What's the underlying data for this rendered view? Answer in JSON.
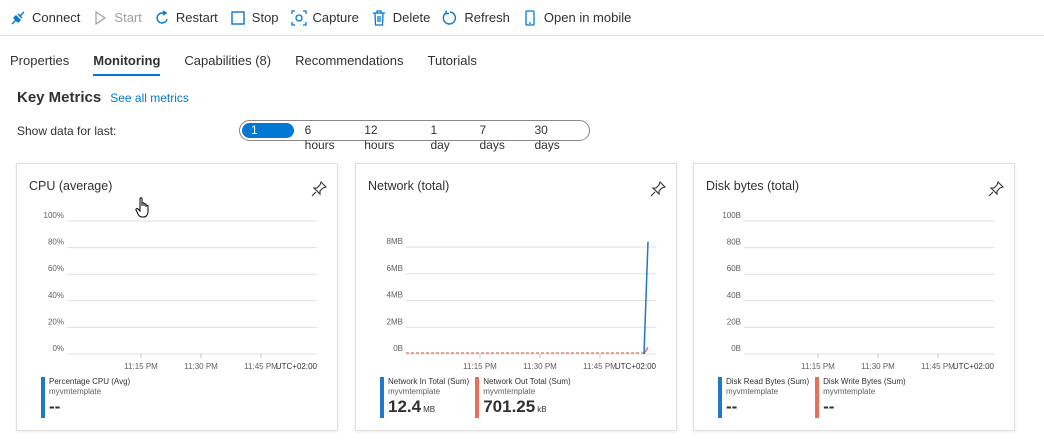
{
  "toolbar": {
    "connect": "Connect",
    "start": "Start",
    "restart": "Restart",
    "stop": "Stop",
    "capture": "Capture",
    "delete": "Delete",
    "refresh": "Refresh",
    "open_mobile": "Open in mobile"
  },
  "tabs": [
    "Properties",
    "Monitoring",
    "Capabilities (8)",
    "Recommendations",
    "Tutorials"
  ],
  "active_tab": "Monitoring",
  "key_metrics": {
    "title": "Key Metrics",
    "link": "See all metrics"
  },
  "show_data": {
    "label": "Show data for last:",
    "options": [
      "1 hour",
      "6 hours",
      "12 hours",
      "1 day",
      "7 days",
      "30 days"
    ],
    "selected": "1 hour"
  },
  "colors": {
    "accent": "#0078d4",
    "series_blue": "#1f78c8",
    "series_orange": "#e8705a"
  },
  "cards": [
    {
      "title": "CPU (average)",
      "chart_data": {
        "type": "line",
        "y_ticks": [
          "100%",
          "80%",
          "60%",
          "40%",
          "20%",
          "0%"
        ],
        "x_ticks": [
          "11:15 PM",
          "11:30 PM",
          "11:45 PM"
        ],
        "timezone": "UTC+02:00",
        "series": [
          {
            "name": "Percentage CPU (Avg)",
            "x": [],
            "y": []
          }
        ]
      },
      "legend": [
        {
          "name": "Percentage CPU (Avg)",
          "resource": "myvmtemplate",
          "value": "--",
          "unit": "",
          "color": "#1f78c8"
        }
      ]
    },
    {
      "title": "Network (total)",
      "chart_data": {
        "type": "line",
        "y_ticks": [
          "8MB",
          "6MB",
          "4MB",
          "2MB",
          "0B"
        ],
        "y_values_mb": [
          8,
          6,
          4,
          2,
          0
        ],
        "x_ticks": [
          "11:15 PM",
          "11:30 PM",
          "11:45 PM"
        ],
        "timezone": "UTC+02:00",
        "series": [
          {
            "name": "Network In Total (Sum)",
            "x": [
              "11:56 PM",
              "11:57 PM"
            ],
            "y": [
              0,
              8.4
            ]
          },
          {
            "name": "Network Out Total (Sum)",
            "x": [
              "11:56 PM",
              "11:57 PM"
            ],
            "y": [
              0,
              0.5
            ]
          }
        ]
      },
      "legend": [
        {
          "name": "Network In Total (Sum)",
          "resource": "myvmtemplate",
          "value": "12.4",
          "unit": "MB",
          "color": "#1f78c8"
        },
        {
          "name": "Network Out Total (Sum)",
          "resource": "myvmtemplate",
          "value": "701.25",
          "unit": "kB",
          "color": "#e8705a"
        }
      ]
    },
    {
      "title": "Disk bytes (total)",
      "chart_data": {
        "type": "line",
        "y_ticks": [
          "100B",
          "80B",
          "60B",
          "40B",
          "20B",
          "0B"
        ],
        "x_ticks": [
          "11:15 PM",
          "11:30 PM",
          "11:45 PM"
        ],
        "timezone": "UTC+02:00",
        "series": [
          {
            "name": "Disk Read Bytes (Sum)",
            "x": [],
            "y": []
          },
          {
            "name": "Disk Write Bytes (Sum)",
            "x": [],
            "y": []
          }
        ]
      },
      "legend": [
        {
          "name": "Disk Read Bytes (Sum)",
          "resource": "myvmtemplate",
          "value": "--",
          "unit": "",
          "color": "#1f78c8"
        },
        {
          "name": "Disk Write Bytes (Sum)",
          "resource": "myvmtemplate",
          "value": "--",
          "unit": "",
          "color": "#e8705a"
        }
      ]
    }
  ]
}
